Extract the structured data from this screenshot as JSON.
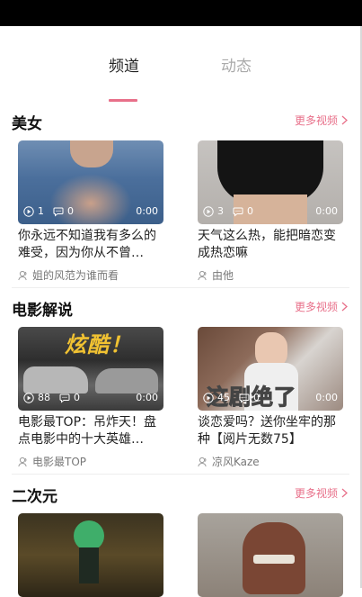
{
  "tabs": [
    {
      "label": "频道",
      "active": true
    },
    {
      "label": "动态",
      "active": false
    }
  ],
  "sections": [
    {
      "title": "美女",
      "more_label": "更多视频",
      "cards": [
        {
          "plays": "1",
          "comments": "0",
          "duration": "0:00",
          "title": "你永远不知道我有多么的难受，因为你从不曾…",
          "author": "姐的风范为谁而看"
        },
        {
          "plays": "3",
          "comments": "0",
          "duration": "0:00",
          "title": "天气这么热，能把暗恋变成热恋嘛",
          "author": "由他"
        }
      ]
    },
    {
      "title": "电影解说",
      "more_label": "更多视频",
      "cards": [
        {
          "plays": "88",
          "comments": "0",
          "duration": "0:00",
          "title": "电影最TOP：吊炸天！盘点电影中的十大英雄…",
          "author": "电影最TOP",
          "thumb_text": "炫酷！"
        },
        {
          "plays": "45",
          "comments": "0",
          "duration": "0:00",
          "title": "谈恋爱吗？送你坐牢的那种【阅片无数75】",
          "author": "凉风Kaze",
          "thumb_text": "这剧绝了"
        }
      ]
    },
    {
      "title": "二次元",
      "more_label": "更多视频",
      "cards": [
        {
          "plays": "",
          "comments": "",
          "duration": ""
        },
        {
          "plays": "",
          "comments": "",
          "duration": ""
        }
      ]
    }
  ],
  "icons": {
    "play": "play-circle-icon",
    "comment": "comment-bubble-icon",
    "author": "user-icon",
    "more": "chevron-right-icon"
  },
  "colors": {
    "accent": "#e8708a"
  }
}
